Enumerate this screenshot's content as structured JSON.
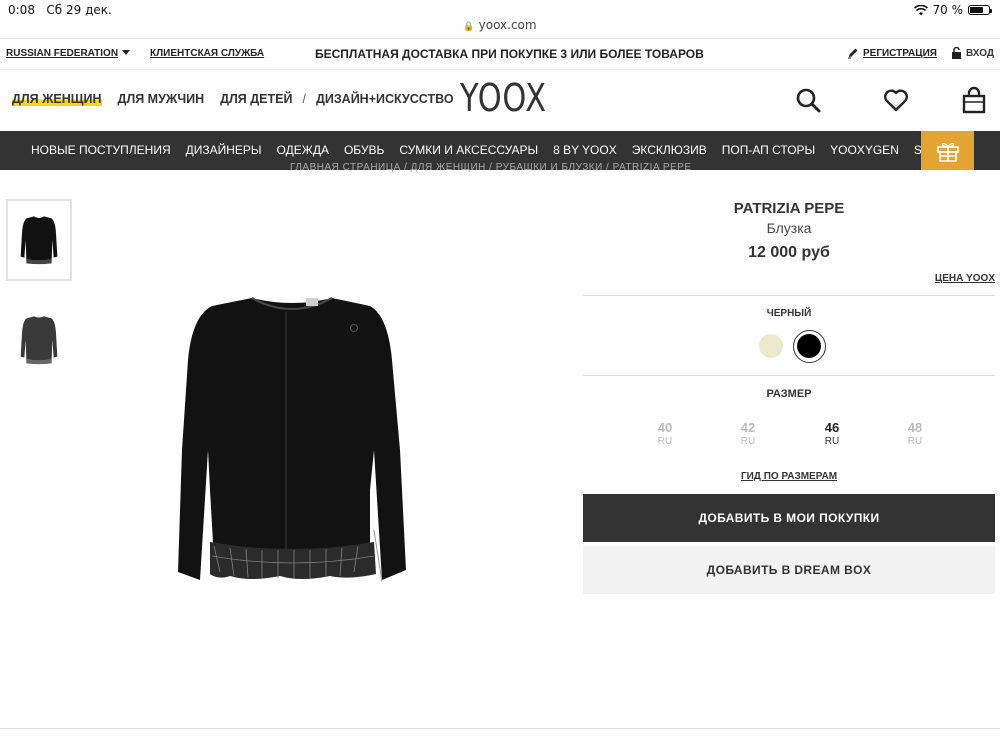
{
  "status_bar": {
    "time": "0:08",
    "date": "Сб 29 дек.",
    "battery": "70 %",
    "battery_level": 0.7
  },
  "browser": {
    "url": "yoox.com"
  },
  "topbar": {
    "country": "RUSSIAN FEDERATION",
    "customer_service": "КЛИЕНТСКАЯ СЛУЖБА",
    "promo": "БЕСПЛАТНАЯ ДОСТАВКА ПРИ ПОКУПКЕ 3 ИЛИ БОЛЕЕ ТОВАРОВ",
    "register": "РЕГИСТРАЦИЯ",
    "login": "ВХОД"
  },
  "header": {
    "gender_nav": [
      "ДЛЯ ЖЕНЩИН",
      "ДЛЯ МУЖЧИН",
      "ДЛЯ ДЕТЕЙ"
    ],
    "separator": "/",
    "design_art": "ДИЗАЙН+ИСКУССТВО",
    "logo": "YOOX",
    "active_gender": "ДЛЯ ЖЕНЩИН"
  },
  "catnav": {
    "items": [
      "НОВЫЕ ПОСТУПЛЕНИЯ",
      "ДИЗАЙНЕРЫ",
      "ОДЕЖДА",
      "ОБУВЬ",
      "СУМКИ И АКСЕССУАРЫ",
      "8 BY YOOX",
      "ЭКСКЛЮЗИВ",
      "ПОП-АП СТОРЫ",
      "YOOXYGEN",
      "SALE"
    ],
    "gift_color": "#e2a533"
  },
  "breadcrumb": "ГЛАВНАЯ СТРАНИЦА / ДЛЯ ЖЕНЩИН / РУБАШКИ И БЛУЗКИ / PATRIZIA PEPE",
  "product": {
    "brand": "PATRIZIA PEPE",
    "type": "Блузка",
    "price": "12 000 руб",
    "price_note": "ЦЕНА YOOX",
    "color_label": "ЧЕРНЫЙ",
    "colors": [
      {
        "name": "cream",
        "hex": "#ece9cf"
      },
      {
        "name": "black",
        "hex": "#000000",
        "selected": true
      }
    ],
    "size_label": "РАЗМЕР",
    "sizes": [
      {
        "value": "40",
        "system": "RU",
        "selected": false
      },
      {
        "value": "42",
        "system": "RU",
        "selected": false
      },
      {
        "value": "46",
        "system": "RU",
        "selected": true
      },
      {
        "value": "48",
        "system": "RU",
        "selected": false
      }
    ],
    "size_guide": "ГИД ПО РАЗМЕРАМ",
    "add_to_cart": "ДОБАВИТЬ В МОИ ПОКУПКИ",
    "add_to_dreambox": "ДОБАВИТЬ В DREAM BOX"
  }
}
